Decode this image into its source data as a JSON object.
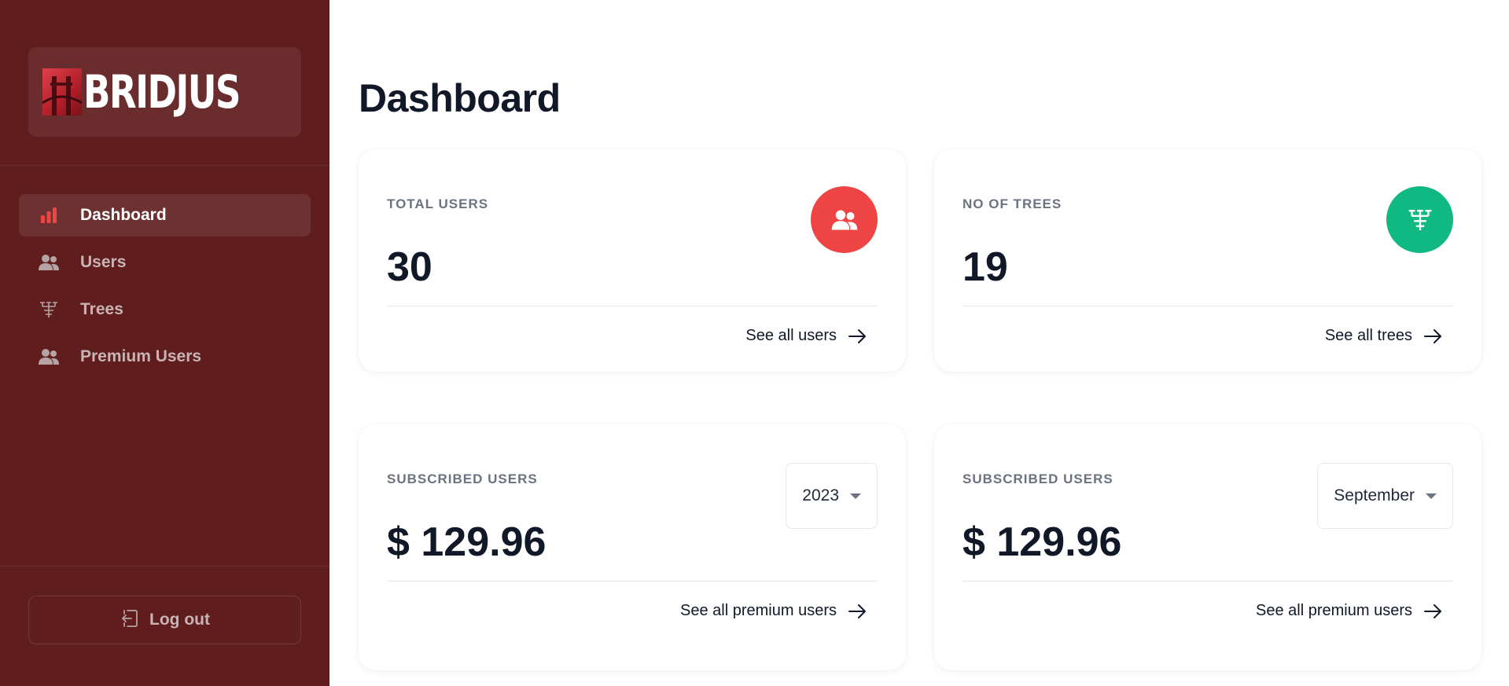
{
  "brand": {
    "name": "BRIDJUS"
  },
  "sidebar": {
    "items": [
      {
        "label": "Dashboard",
        "icon": "bar-chart-icon",
        "active": true
      },
      {
        "label": "Users",
        "icon": "users-icon",
        "active": false
      },
      {
        "label": "Trees",
        "icon": "tree-icon",
        "active": false
      },
      {
        "label": "Premium Users",
        "icon": "users-icon",
        "active": false
      }
    ],
    "logout_label": "Log out"
  },
  "page": {
    "title": "Dashboard"
  },
  "cards": {
    "total_users": {
      "label": "TOTAL USERS",
      "value": "30",
      "link": "See all users",
      "icon": "users-icon",
      "icon_color": "#ef4444"
    },
    "trees": {
      "label": "NO OF TREES",
      "value": "19",
      "link": "See all trees",
      "icon": "tree-icon",
      "icon_color": "#10b981"
    },
    "subscribed_year": {
      "label": "SUBSCRIBED USERS",
      "value": "$ 129.96",
      "link": "See all premium users",
      "select_value": "2023"
    },
    "subscribed_month": {
      "label": "SUBSCRIBED USERS",
      "value": "$ 129.96",
      "link": "See all premium users",
      "select_value": "September"
    }
  },
  "colors": {
    "sidebar_bg": "#5f1d1d",
    "accent_red": "#ef4444",
    "accent_green": "#10b981"
  }
}
